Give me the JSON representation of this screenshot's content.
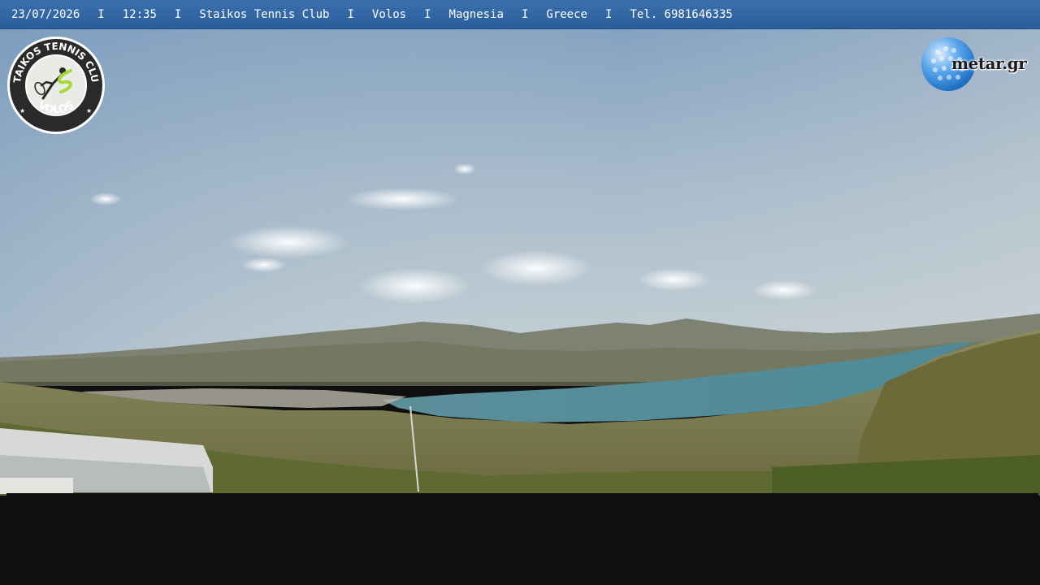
{
  "overlay": {
    "date": "23/07/2026",
    "time": "12:35",
    "club": "Staikos Tennis Club",
    "city": "Volos",
    "region": "Magnesia",
    "country": "Greece",
    "phone": "Tel. 6981646335",
    "separator": "I"
  },
  "logo_club": {
    "top_text": "STAIKOS TENNIS CLUB",
    "bottom_text": "VOLOS",
    "icon": "tennis-player-icon"
  },
  "logo_metar": {
    "text": "metar.gr",
    "icon": "golf-ball-globe-icon"
  },
  "colors": {
    "topbar": "#2f64a3",
    "sky_top": "#7e9fbf",
    "sea": "#4e8a96",
    "mask": "#0f0f0f",
    "logo_accent": "#a8d83a"
  }
}
